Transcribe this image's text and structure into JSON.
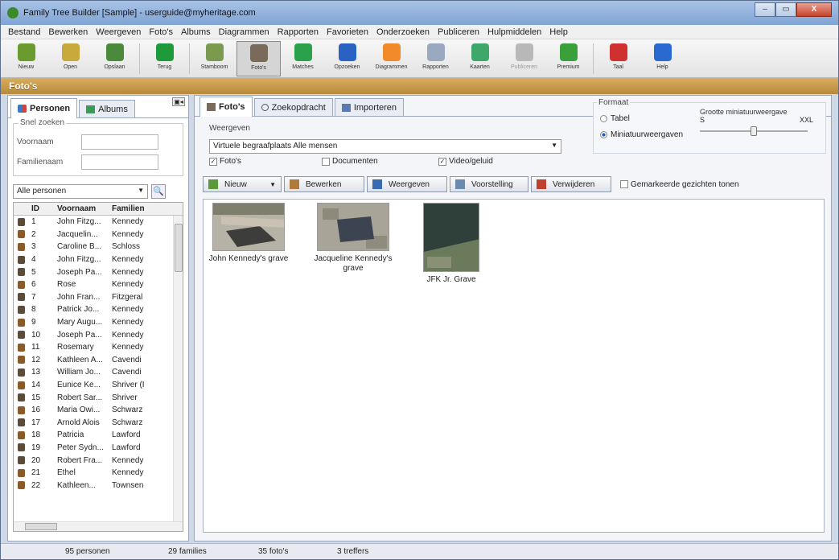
{
  "window": {
    "title": "Family Tree Builder [Sample] - userguide@myheritage.com",
    "min_label": "–",
    "max_label": "▭",
    "close_label": "X"
  },
  "menu": [
    "Bestand",
    "Bewerken",
    "Weergeven",
    "Foto's",
    "Albums",
    "Diagrammen",
    "Rapporten",
    "Favorieten",
    "Onderzoeken",
    "Publiceren",
    "Hulpmiddelen",
    "Help"
  ],
  "toolbar": [
    {
      "label": "Nieuw",
      "icon": "new-file-icon",
      "color": "#6a9b2f"
    },
    {
      "label": "Open",
      "icon": "open-folder-icon",
      "color": "#c8a93c"
    },
    {
      "label": "Opslaan",
      "icon": "save-icon",
      "color": "#4a8a3a"
    },
    {
      "label": "Terug",
      "icon": "back-arrow-icon",
      "color": "#1f9a3a"
    },
    {
      "label": "Stamboom",
      "icon": "family-tree-icon",
      "color": "#7a9a50"
    },
    {
      "label": "Foto's",
      "icon": "photos-icon",
      "color": "#7a6a5a"
    },
    {
      "label": "Matches",
      "icon": "matches-icon",
      "color": "#2aa14a"
    },
    {
      "label": "Opzoeken",
      "icon": "lookup-icon",
      "color": "#2a62c4"
    },
    {
      "label": "Diagrammen",
      "icon": "charts-icon",
      "color": "#f08a2a"
    },
    {
      "label": "Rapporten",
      "icon": "reports-icon",
      "color": "#9aa8c0"
    },
    {
      "label": "Kaarten",
      "icon": "maps-icon",
      "color": "#3ea86a"
    },
    {
      "label": "Publiceren",
      "icon": "publish-icon",
      "color": "#b8b8b8"
    },
    {
      "label": "Premium",
      "icon": "premium-tree-icon",
      "color": "#3aa03a"
    },
    {
      "label": "Taal",
      "icon": "language-flag-icon",
      "color": "#d03030"
    },
    {
      "label": "Help",
      "icon": "help-icon",
      "color": "#2a6ad0"
    }
  ],
  "section_title": "Foto's",
  "left": {
    "tabs": [
      {
        "label": "Personen"
      },
      {
        "label": "Albums"
      }
    ],
    "quick_search": {
      "legend": "Snel zoeken",
      "first_label": "Voornaam",
      "last_label": "Familienaam",
      "first_value": "",
      "last_value": ""
    },
    "filter": "Alle personen",
    "columns": {
      "id": "ID",
      "first": "Voornaam",
      "last": "Familien"
    },
    "rows": [
      {
        "id": "1",
        "first": "John Fitzg...",
        "last": "Kennedy",
        "g": "m"
      },
      {
        "id": "2",
        "first": "Jacquelin...",
        "last": "Kennedy",
        "g": "f"
      },
      {
        "id": "3",
        "first": "Caroline B...",
        "last": "Schloss",
        "g": "f"
      },
      {
        "id": "4",
        "first": "John Fitzg...",
        "last": "Kennedy",
        "g": "m"
      },
      {
        "id": "5",
        "first": "Joseph Pa...",
        "last": "Kennedy",
        "g": "m"
      },
      {
        "id": "6",
        "first": "Rose",
        "last": "Kennedy",
        "g": "f"
      },
      {
        "id": "7",
        "first": "John Fran...",
        "last": "Fitzgeral",
        "g": "m"
      },
      {
        "id": "8",
        "first": "Patrick Jo...",
        "last": "Kennedy",
        "g": "m"
      },
      {
        "id": "9",
        "first": "Mary Augu...",
        "last": "Kennedy",
        "g": "f"
      },
      {
        "id": "10",
        "first": "Joseph Pa...",
        "last": "Kennedy",
        "g": "m"
      },
      {
        "id": "11",
        "first": "Rosemary",
        "last": "Kennedy",
        "g": "f"
      },
      {
        "id": "12",
        "first": "Kathleen A...",
        "last": "Cavendi",
        "g": "f"
      },
      {
        "id": "13",
        "first": "William Jo...",
        "last": "Cavendi",
        "g": "m"
      },
      {
        "id": "14",
        "first": "Eunice Ke...",
        "last": "Shriver (I",
        "g": "f"
      },
      {
        "id": "15",
        "first": "Robert Sar...",
        "last": "Shriver",
        "g": "m"
      },
      {
        "id": "16",
        "first": "Maria Owi...",
        "last": "Schwarz",
        "g": "f"
      },
      {
        "id": "17",
        "first": "Arnold Alois",
        "last": "Schwarz",
        "g": "m"
      },
      {
        "id": "18",
        "first": "Patricia",
        "last": "Lawford",
        "g": "f"
      },
      {
        "id": "19",
        "first": "Peter Sydn...",
        "last": "Lawford",
        "g": "m"
      },
      {
        "id": "20",
        "first": "Robert Fra...",
        "last": "Kennedy",
        "g": "m"
      },
      {
        "id": "21",
        "first": "Ethel",
        "last": "Kennedy",
        "g": "f"
      },
      {
        "id": "22",
        "first": "Kathleen...",
        "last": "Townsen",
        "g": "f"
      }
    ]
  },
  "right": {
    "tabs": [
      {
        "label": "Foto's"
      },
      {
        "label": "Zoekopdracht"
      },
      {
        "label": "Importeren"
      }
    ],
    "view_label": "Weergeven",
    "view_value": "Virtuele begraafplaats Alle mensen",
    "checks": [
      {
        "label": "Foto's",
        "checked": true
      },
      {
        "label": "Documenten",
        "checked": false
      },
      {
        "label": "Video/geluid",
        "checked": true
      }
    ],
    "format": {
      "legend": "Formaat",
      "table_label": "Tabel",
      "thumb_label": "Miniatuurweergaven",
      "size_label": "Grootte miniatuurweergave",
      "size_min": "S",
      "size_max": "XXL",
      "size_value": 0.5
    },
    "actions": [
      "Nieuw",
      "Bewerken",
      "Weergeven",
      "Voorstelling",
      "Verwijderen"
    ],
    "marked_faces_label": "Gemarkeerde gezichten tonen",
    "photos": [
      {
        "caption": "John Kennedy's grave"
      },
      {
        "caption": "Jacqueline Kennedy's grave"
      },
      {
        "caption": "JFK Jr. Grave"
      }
    ]
  },
  "status": {
    "persons": "95 personen",
    "families": "29 families",
    "photos": "35 foto's",
    "hits": "3 treffers"
  }
}
